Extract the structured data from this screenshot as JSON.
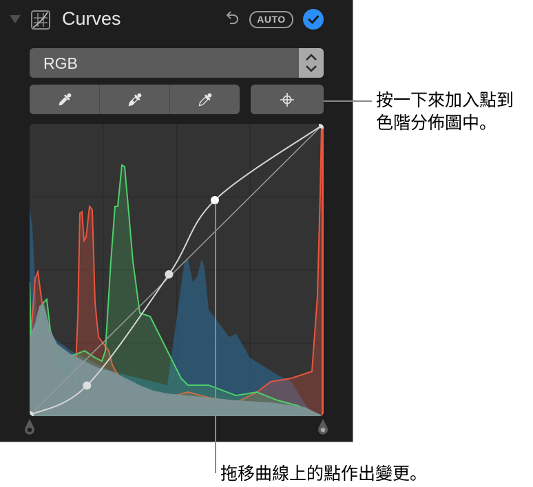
{
  "panel": {
    "title": "Curves",
    "auto_label": "AUTO",
    "accent_color": "#2b8ef6",
    "icons": {
      "disclosure": "disclosure-triangle-icon",
      "section": "curves-grid-icon",
      "undo": "undo-arrow-icon",
      "confirm": "checkmark-circle-icon"
    }
  },
  "channel_select": {
    "selected": "RGB",
    "icon": "up-down-chevron-icon"
  },
  "eyedroppers": [
    {
      "name": "black-point-eyedropper",
      "icon": "eyedropper-filled-icon"
    },
    {
      "name": "gray-point-eyedropper",
      "icon": "eyedropper-half-icon"
    },
    {
      "name": "white-point-eyedropper",
      "icon": "eyedropper-outline-icon"
    }
  ],
  "add_point_button": {
    "icon": "crosshair-icon"
  },
  "histogram": {
    "channel_colors": {
      "red": "#e8553f",
      "green": "#4fcf6a",
      "blue": "#2e5f82",
      "luminance": "#7c9497"
    },
    "curve_points": [
      [
        0,
        0
      ],
      [
        0.194,
        0.101
      ],
      [
        0.475,
        0.485
      ],
      [
        0.632,
        0.741
      ],
      [
        1,
        1
      ]
    ],
    "black_point": 0,
    "white_point": 1
  },
  "callouts": {
    "add_point": [
      "按一下來加入點到",
      "色階分佈圖中。"
    ],
    "drag_point": "拖移曲線上的點作出變更。"
  }
}
